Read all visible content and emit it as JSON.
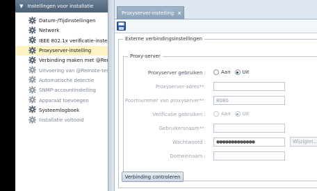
{
  "sidebar": {
    "header": "Instellingen voor installatie",
    "items": [
      {
        "label": "Datum-/Tijdinstellingen",
        "state": "normal"
      },
      {
        "label": "Netwerk",
        "state": "normal"
      },
      {
        "label": "IEEE 802.1x verificatie-instell",
        "state": "normal"
      },
      {
        "label": "Proxyserver-instelling",
        "state": "selected"
      },
      {
        "label": "Verbinding maken met @Rer",
        "state": "normal"
      },
      {
        "label": "Uitvoering van @Remote-tes",
        "state": "disabled"
      },
      {
        "label": "Automatische detectie",
        "state": "disabled"
      },
      {
        "label": "SNMP-accountinstelling",
        "state": "disabled"
      },
      {
        "label": "Apparaat toevoegen",
        "state": "disabled"
      },
      {
        "label": "Systeemlogboek",
        "state": "normal"
      },
      {
        "label": "Installatie voltooid",
        "state": "disabled"
      }
    ]
  },
  "tab": {
    "label": "Proxyserver-instelling",
    "close": "×"
  },
  "form": {
    "outer_legend": "Externe verbindingsinstellingen",
    "inner_legend": "Proxy-server",
    "use_proxy": {
      "label": "Proxyserver gebruiken :",
      "option_on": "Aan",
      "option_off": "Uit",
      "selected": "Uit"
    },
    "address": {
      "label": "Proxyserver-adres**:",
      "value": ""
    },
    "port": {
      "label": "Poortnummer van proxyserver**:",
      "value": "8080"
    },
    "auth": {
      "label": "Verificatie gebruiken :",
      "option_on": "Aan",
      "option_off": "Uit",
      "selected": "Uit"
    },
    "username": {
      "label": "Gebruikersnaam**:",
      "value": ""
    },
    "password": {
      "label": "Wachtwoord :",
      "value": "●●●●●●●●●●●●●"
    },
    "change_button": "Wijzigen...",
    "domain": {
      "label": "Domeinnaam :",
      "value": ""
    },
    "check_button": "Verbinding controleren"
  },
  "colors": {
    "selected_bg": "#fdf2c4",
    "header_bg": "#4c6078",
    "tab_bg": "#8aa1ba"
  }
}
